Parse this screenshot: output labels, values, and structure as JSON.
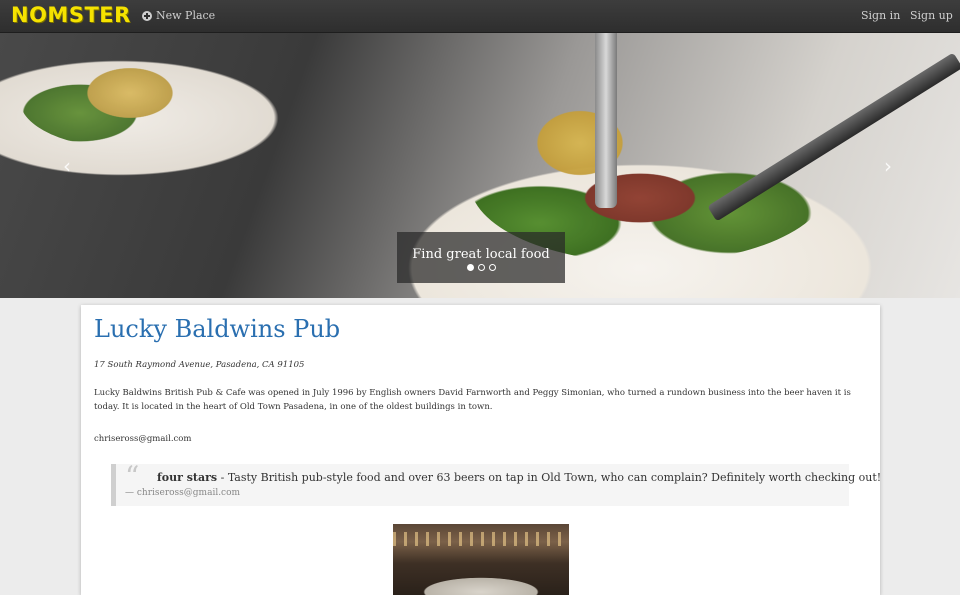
{
  "navbar": {
    "brand": "NOMSTER",
    "new_place_label": "New Place",
    "sign_in_label": "Sign in",
    "sign_up_label": "Sign up"
  },
  "hero": {
    "caption": "Find great local food",
    "slide_count": 3,
    "active_slide": 1
  },
  "place": {
    "name": "Lucky Baldwins Pub",
    "address": "17 South Raymond Avenue, Pasadena, CA 91105",
    "description": "Lucky Baldwins British Pub & Cafe was opened in July 1996 by English owners David Farnworth and Peggy Simonian, who turned a rundown business into the beer haven it is today. It is located in the heart of Old Town Pasadena, in one of the oldest buildings in town.",
    "owner_email": "chriseross@gmail.com"
  },
  "review": {
    "rating": "four stars",
    "separator": " - ",
    "comment": "Tasty British pub-style food and over 63 beers on tap in Old Town, who can complain? Definitely worth checking out!",
    "author": "— chriseross@gmail.com"
  },
  "colors": {
    "brand": "#f5e200",
    "title_link": "#2a6fb0",
    "navbar_bg": "#333333"
  }
}
